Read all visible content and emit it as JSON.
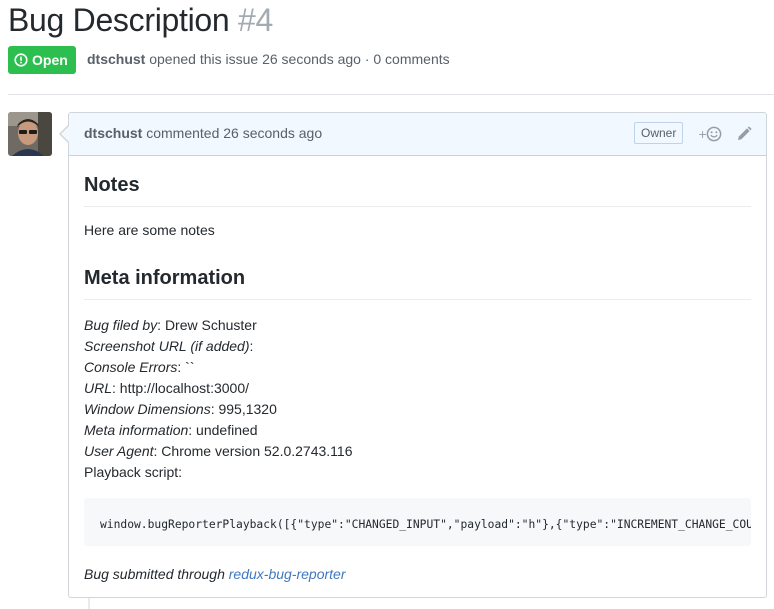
{
  "issue": {
    "title": "Bug Description",
    "number": "#4",
    "state": "Open",
    "author": "dtschust",
    "meta_text": " opened this issue 26 seconds ago · 0 comments"
  },
  "comment": {
    "author": "dtschust",
    "time_text": " commented 26 seconds ago",
    "role_label": "Owner",
    "reaction_icon": "smiley-add-icon",
    "edit_icon": "pencil-icon",
    "notes_heading": "Notes",
    "notes_text": "Here are some notes",
    "meta_heading": "Meta information",
    "fields": [
      {
        "label": "Bug filed by",
        "value": ": Drew Schuster"
      },
      {
        "label": "Screenshot URL (if added)",
        "value": ":"
      },
      {
        "label": "Console Errors",
        "value": ": ``"
      },
      {
        "label": "URL",
        "value": ": http://localhost:3000/"
      },
      {
        "label": "Window Dimensions",
        "value": ": 995,1320"
      },
      {
        "label": "Meta information",
        "value": ": undefined"
      },
      {
        "label": "User Agent",
        "value": ": Chrome version 52.0.2743.116"
      }
    ],
    "playback_label": "Playback script:",
    "code": "window.bugReporterPlayback([{\"type\":\"CHANGED_INPUT\",\"payload\":\"h\"},{\"type\":\"INCREMENT_CHANGE_COUNTER\"",
    "footer_text": "Bug submitted through ",
    "footer_link": "redux-bug-reporter"
  },
  "colors": {
    "open_green": "#2cbe4e",
    "header_blue": "#f1f8ff",
    "link_blue": "#4078c0"
  }
}
